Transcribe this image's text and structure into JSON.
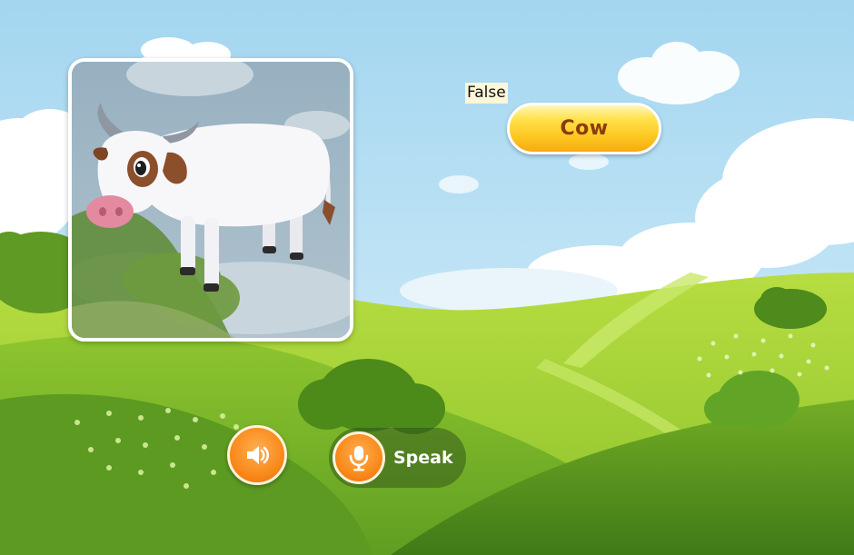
{
  "debug_label": "False",
  "answer": {
    "label": "Cow"
  },
  "picture": {
    "subject": "cow"
  },
  "controls": {
    "sound_icon": "speaker-icon",
    "speak_icon": "microphone-icon",
    "speak_label": "Speak"
  },
  "colors": {
    "sky_top": "#a9d9f1",
    "sky_bottom": "#d6eef9",
    "grass_light": "#a6d23a",
    "grass_dark": "#4f8f1f",
    "button_orange": "#f98a1b",
    "answer_yellow": "#fcc51f",
    "answer_text": "#8a3c0c"
  }
}
